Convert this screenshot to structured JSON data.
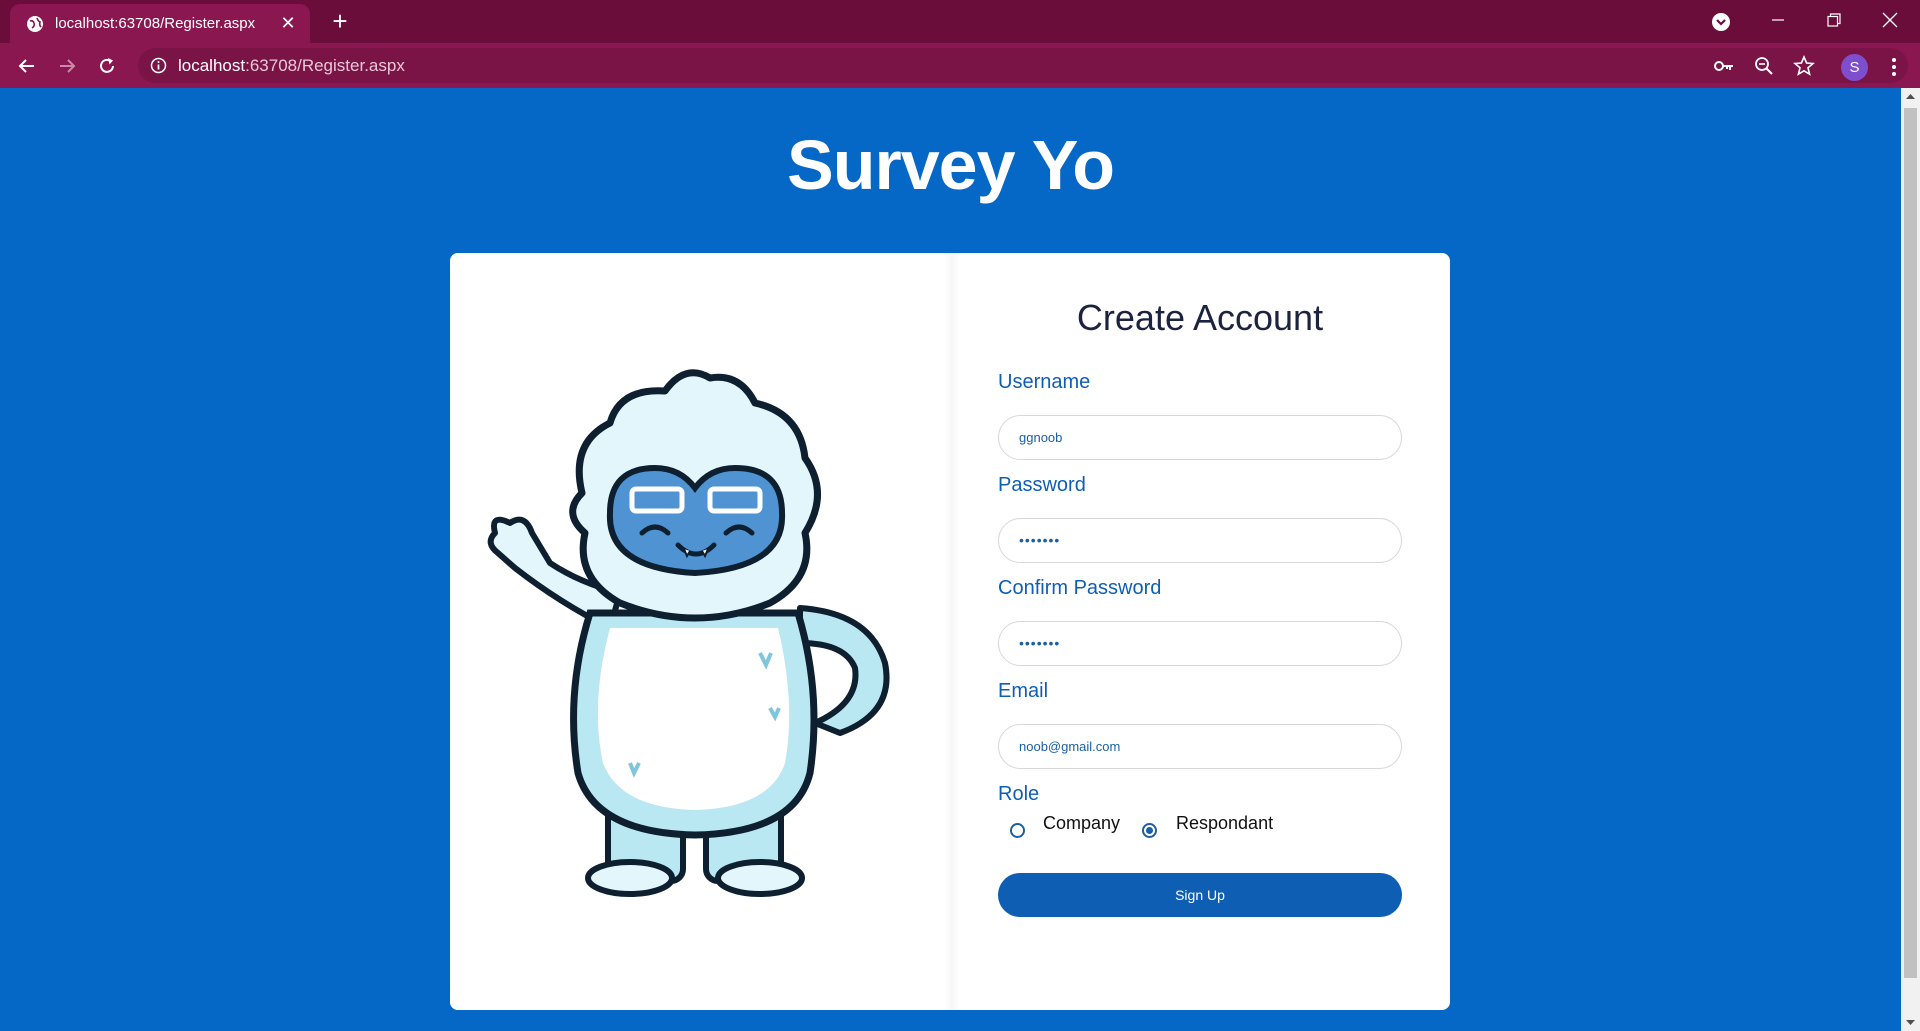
{
  "browser": {
    "tab_title": "localhost:63708/Register.aspx",
    "url_host": "localhost",
    "url_rest": ":63708/Register.aspx",
    "profile_initial": "S",
    "theme_colors": {
      "tabbar": "#6b0d3a",
      "toolbar": "#8a1750"
    }
  },
  "page": {
    "site_title": "Survey Yo",
    "background_color": "#0568c6"
  },
  "form": {
    "title": "Create Account",
    "username": {
      "label": "Username",
      "value": "ggnoob"
    },
    "password": {
      "label": "Password",
      "value": "•••••••"
    },
    "confirm_password": {
      "label": "Confirm Password",
      "value": "•••••••"
    },
    "email": {
      "label": "Email",
      "value": "noob@gmail.com"
    },
    "role": {
      "label": "Role",
      "options": [
        {
          "label": "Company",
          "selected": false
        },
        {
          "label": "Respondant",
          "selected": true
        }
      ]
    },
    "submit_label": "Sign Up",
    "accent_color": "#0e5fb4"
  },
  "illustration": {
    "subject": "yeti-mascot-waving"
  }
}
